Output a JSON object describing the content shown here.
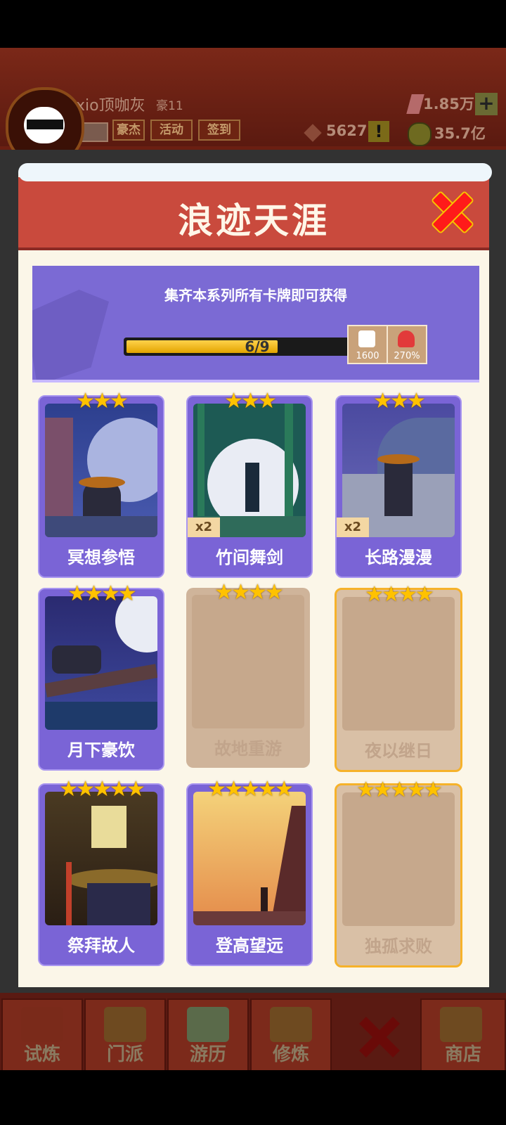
{
  "hud": {
    "player_name": "xio顶咖灰",
    "level": "豪11",
    "gems": "1.85万",
    "plus_label": "+",
    "tokens": "5627",
    "coins": "35.7亿",
    "alert_label": "!",
    "buttons": [
      "豪杰",
      "活动",
      "签到"
    ]
  },
  "dialog": {
    "title": "浪迹天涯",
    "series": {
      "description": "集齐本系列所有卡牌即可获得",
      "progress_text": "6/9",
      "progress_fraction": 0.667,
      "rewards": [
        {
          "icon": "dice-icon",
          "label": "1600"
        },
        {
          "icon": "heart-icon",
          "label": "270%"
        }
      ]
    },
    "cards": [
      {
        "name": "冥想参悟",
        "stars": "★★★",
        "owned": true,
        "count": ""
      },
      {
        "name": "竹间舞剑",
        "stars": "★★★",
        "owned": true,
        "count": "x2"
      },
      {
        "name": "长路漫漫",
        "stars": "★★★",
        "owned": true,
        "count": "x2"
      },
      {
        "name": "月下豪饮",
        "stars": "★★★★",
        "owned": true,
        "count": ""
      },
      {
        "name": "故地重游",
        "stars": "★★★★",
        "owned": false,
        "count": ""
      },
      {
        "name": "夜以继日",
        "stars": "★★★★",
        "owned": false,
        "count": ""
      },
      {
        "name": "祭拜故人",
        "stars": "★★★★★",
        "owned": true,
        "count": ""
      },
      {
        "name": "登高望远",
        "stars": "★★★★★",
        "owned": true,
        "count": ""
      },
      {
        "name": "独孤求败",
        "stars": "★★★★★",
        "owned": false,
        "count": ""
      }
    ]
  },
  "nav": {
    "items": [
      "试炼",
      "门派",
      "游历",
      "修炼",
      "",
      "商店"
    ]
  },
  "colors": {
    "banner": "#c94a3d",
    "series_bg": "#7b6ad4",
    "card_owned": "#7a64d6",
    "card_locked": "#cfb49a",
    "gold_border": "#f6b22a",
    "star": "#ffc200"
  }
}
